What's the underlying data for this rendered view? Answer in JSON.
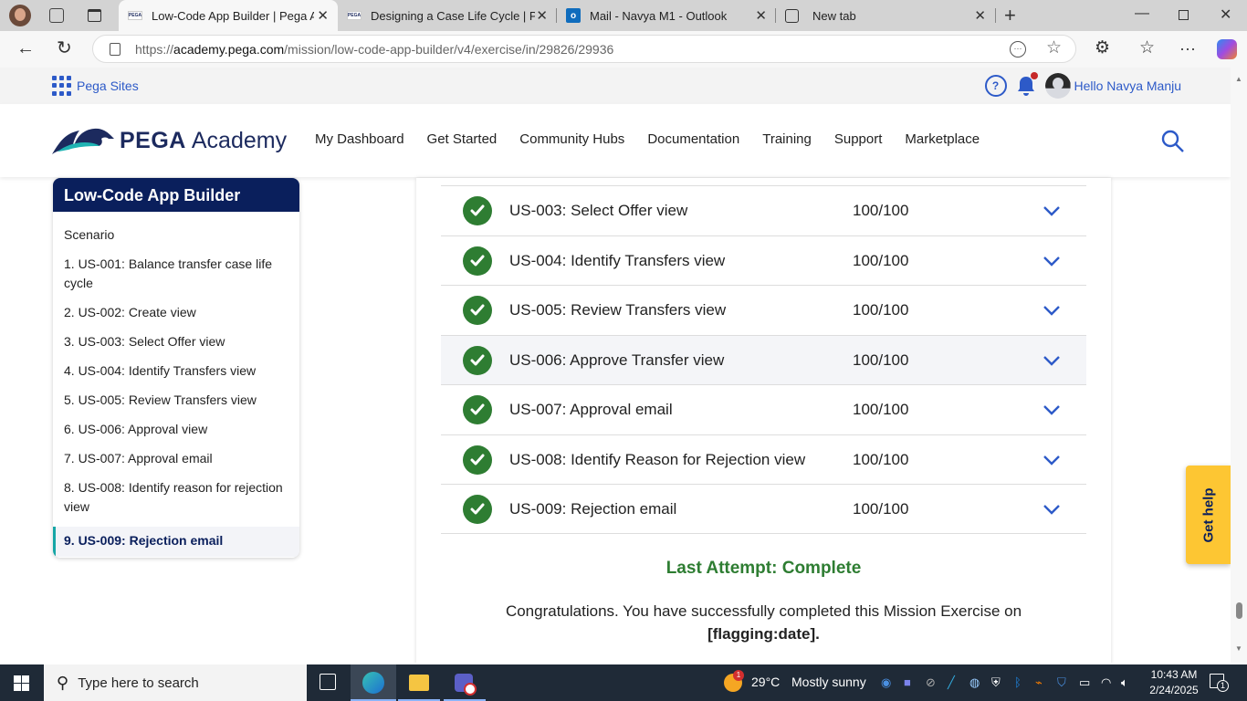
{
  "browser": {
    "tabs": [
      {
        "label": "Low-Code App Builder | Pega Academy",
        "favicon": "PEGA",
        "active": true
      },
      {
        "label": "Designing a Case Life Cycle | Pega Academy",
        "favicon": "PEGA",
        "active": false
      },
      {
        "label": "Mail - Navya M1 - Outlook",
        "favicon": "outlook-icon",
        "active": false
      },
      {
        "label": "New tab",
        "favicon": "new-tab-icon",
        "active": false
      }
    ],
    "url_prefix": "https://",
    "url_domain": "academy.pega.com",
    "url_path": "/mission/low-code-app-builder/v4/exercise/in/29826/29936"
  },
  "site": {
    "pega_sites_label": "Pega Sites",
    "greeting": "Hello Navya Manju",
    "logo_brand": "PEGA",
    "logo_product": "Academy",
    "nav": [
      "My Dashboard",
      "Get Started",
      "Community Hubs",
      "Documentation",
      "Training",
      "Support",
      "Marketplace"
    ]
  },
  "sidebar": {
    "title": "Low-Code App Builder",
    "items": [
      {
        "label": "Scenario",
        "active": false
      },
      {
        "label": "1. US-001: Balance transfer case life cycle",
        "active": false
      },
      {
        "label": "2. US-002: Create view",
        "active": false
      },
      {
        "label": "3. US-003: Select Offer view",
        "active": false
      },
      {
        "label": "4. US-004: Identify Transfers view",
        "active": false
      },
      {
        "label": "5. US-005: Review Transfers view",
        "active": false
      },
      {
        "label": "6. US-006: Approval view",
        "active": false
      },
      {
        "label": "7. US-007: Approval email",
        "active": false
      },
      {
        "label": "8. US-008: Identify reason for rejection view",
        "active": false
      },
      {
        "label": "9. US-009: Rejection email",
        "active": true
      }
    ]
  },
  "results": {
    "rows": [
      {
        "name": "US-003: Select Offer view",
        "score": "100/100",
        "status": "complete"
      },
      {
        "name": "US-004: Identify Transfers view",
        "score": "100/100",
        "status": "complete"
      },
      {
        "name": "US-005: Review Transfers view",
        "score": "100/100",
        "status": "complete"
      },
      {
        "name": "US-006: Approve Transfer view",
        "score": "100/100",
        "status": "complete",
        "hovered": true
      },
      {
        "name": "US-007: Approval email",
        "score": "100/100",
        "status": "complete"
      },
      {
        "name": "US-008: Identify Reason for Rejection view",
        "score": "100/100",
        "status": "complete"
      },
      {
        "name": "US-009: Rejection email",
        "score": "100/100",
        "status": "complete"
      }
    ],
    "last_attempt": "Last Attempt: Complete",
    "congrats_text": "Congratulations. You have successfully completed this Mission Exercise on",
    "congrats_date": "[flagging:date]."
  },
  "get_help_label": "Get help",
  "colors": {
    "navy": "#0a1f5c",
    "success_green": "#2e7d32",
    "link_blue": "#2d5ac8",
    "help_yellow": "#fdc633",
    "teal_accent": "#16a6a6"
  },
  "taskbar": {
    "search_placeholder": "Type here to search",
    "weather_temp": "29°C",
    "weather_text": "Mostly sunny",
    "weather_badge": "1",
    "time": "10:43 AM",
    "date": "2/24/2025",
    "notif_count": "1"
  }
}
